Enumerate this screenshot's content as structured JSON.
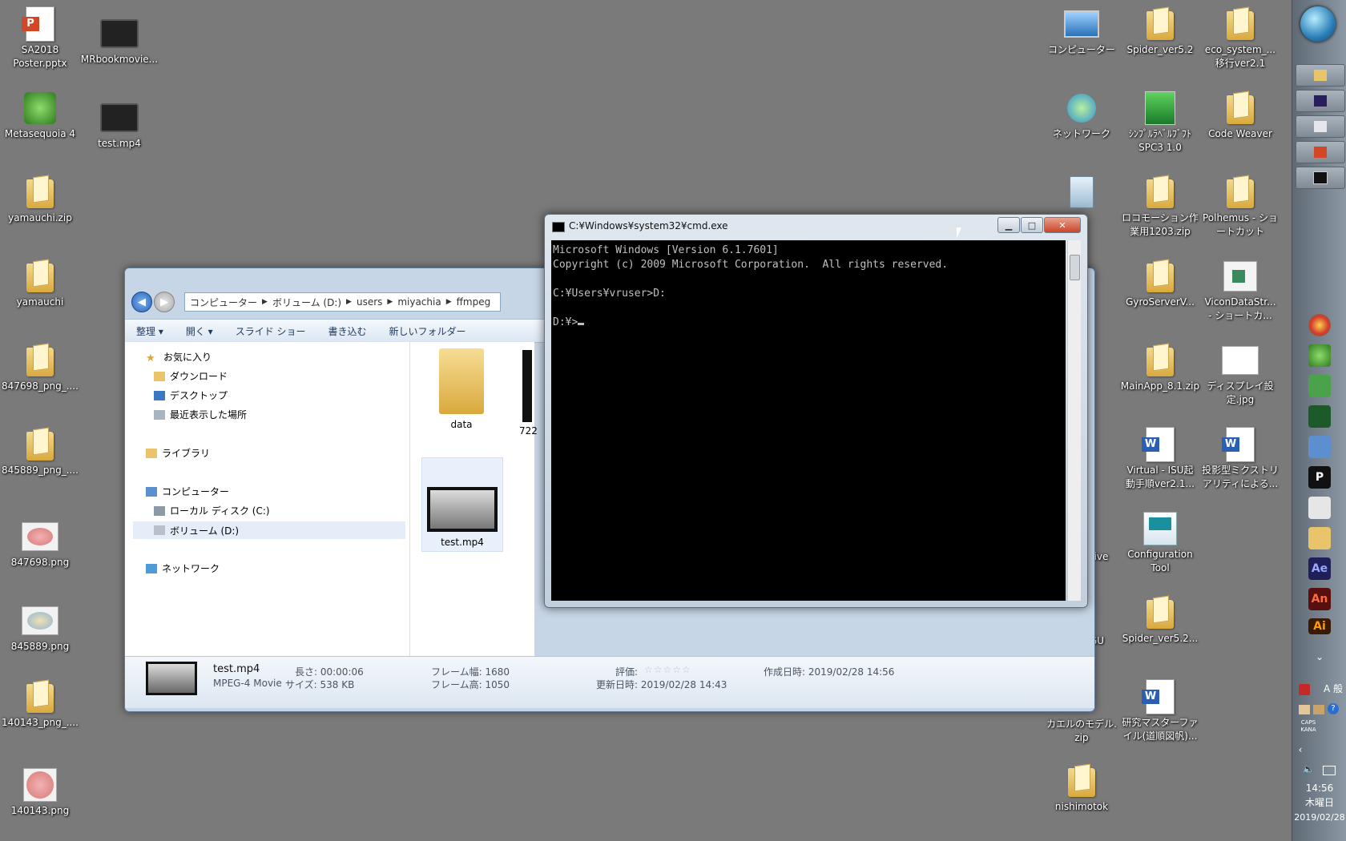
{
  "desktop": {
    "left_icons": [
      {
        "label": "SA2018\nPoster.pptx",
        "kind": "ppt"
      },
      {
        "label": "MRbookmovie...",
        "kind": "video"
      },
      {
        "label": "Metasequoia 4",
        "kind": "app"
      },
      {
        "label": "test.mp4",
        "kind": "video"
      },
      {
        "label": "yamauchi.zip",
        "kind": "zip"
      },
      {
        "label": "yamauchi",
        "kind": "folder"
      },
      {
        "label": "847698_png_....",
        "kind": "zip"
      },
      {
        "label": "845889_png_....",
        "kind": "zip"
      },
      {
        "label": "847698.png",
        "kind": "image"
      },
      {
        "label": "845889.png",
        "kind": "image"
      },
      {
        "label": "140143_png_....",
        "kind": "zip"
      },
      {
        "label": "140143.png",
        "kind": "image"
      }
    ],
    "right_icons": [
      {
        "label": "コンピューター"
      },
      {
        "label": "Spider_ver5.2"
      },
      {
        "label": "eco_system_...\n移行ver2.1"
      },
      {
        "label": "ネットワーク"
      },
      {
        "label": "ｼﾝﾌﾟﾙﾗﾍﾞﾙﾌﾞﾌﾄ\nSPC3 1.0"
      },
      {
        "label": "Code Weaver"
      },
      {
        "label": "ロコモーション作\n業用1203.zip"
      },
      {
        "label": "Polhemus - ショ\nートカット"
      },
      {
        "label": "GyroServerV..."
      },
      {
        "label": "ViconDataStr...\n- ショートカ..."
      },
      {
        "label": "MainApp_8.1.zip"
      },
      {
        "label": "ディスプレイ設\n定.jpg"
      },
      {
        "label": "Virtual - ISU起\n動手順ver2.1..."
      },
      {
        "label": "投影型ミクストリ\nアリティによる..."
      },
      {
        "label": "Configuration\nTool"
      },
      {
        "label": "Spider_ver5.2..."
      },
      {
        "label": "カエルのモデル.\nzip"
      },
      {
        "label": "研究マスターファ\nイル(道順図帆)..."
      },
      {
        "label": "nishimotok"
      }
    ],
    "partial_labels": [
      "stive",
      "GU"
    ]
  },
  "explorer": {
    "breadcrumb": [
      "コンピューター",
      "ボリューム (D:)",
      "users",
      "miyachia",
      "ffmpeg"
    ],
    "toolbar": [
      "整理 ▾",
      "開く ▾",
      "スライド ショー",
      "書き込む",
      "新しいフォルダー"
    ],
    "nav": {
      "favorites": "お気に入り",
      "downloads": "ダウンロード",
      "desktop": "デスクトップ",
      "recent": "最近表示した場所",
      "libraries": "ライブラリ",
      "computer": "コンピューター",
      "local_disk": "ローカル ディスク (C:)",
      "volume_d": "ボリューム (D:)",
      "network": "ネットワーク"
    },
    "files": [
      {
        "name": "data",
        "kind": "folder"
      },
      {
        "name": "test.mp4",
        "kind": "video"
      }
    ],
    "partial_file": "722",
    "details": {
      "name": "test.mp4",
      "type": "MPEG-4 Movie",
      "length": "長さ: 00:00:06",
      "size": "サイズ: 538 KB",
      "frame_width": "フレーム幅: 1680",
      "frame_height": "フレーム高: 1050",
      "rating_label": "評価:",
      "modified": "更新日時: 2019/02/28 14:43",
      "created": "作成日時: 2019/02/28 14:56"
    }
  },
  "cmd": {
    "title": "C:¥Windows¥system32¥cmd.exe",
    "lines": [
      "Microsoft Windows [Version 6.1.7601]",
      "Copyright (c) 2009 Microsoft Corporation.  All rights reserved.",
      "",
      "C:¥Users¥vruser>D:",
      "",
      "D:¥>"
    ]
  },
  "taskbar": {
    "ime": "A 般",
    "caps": "CAPS",
    "kana": "KANA",
    "time": "14:56",
    "weekday": "木曜日",
    "date": "2019/02/28"
  }
}
